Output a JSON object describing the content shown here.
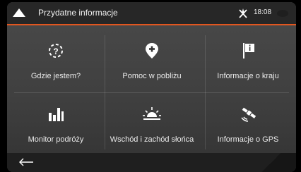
{
  "header": {
    "title": "Przydatne informacje",
    "time": "18:08",
    "back_icon": "up-arrow-icon",
    "gps_icon": "gps-off-icon"
  },
  "tiles": [
    {
      "label": "Gdzie jestem?",
      "icon": "target-location-icon"
    },
    {
      "label": "Pomoc w pobliżu",
      "icon": "pin-plus-icon"
    },
    {
      "label": "Informacje o kraju",
      "icon": "flag-info-icon"
    },
    {
      "label": "Monitor podróży",
      "icon": "bar-chart-icon"
    },
    {
      "label": "Wschód i zachód słońca",
      "icon": "sunset-icon"
    },
    {
      "label": "Informacje o GPS",
      "icon": "satellite-icon"
    }
  ],
  "footer": {
    "back_icon": "back-arrow-icon"
  },
  "colors": {
    "accent": "#e2561f",
    "background": "#3f3f3f",
    "text": "#eaeaea"
  }
}
